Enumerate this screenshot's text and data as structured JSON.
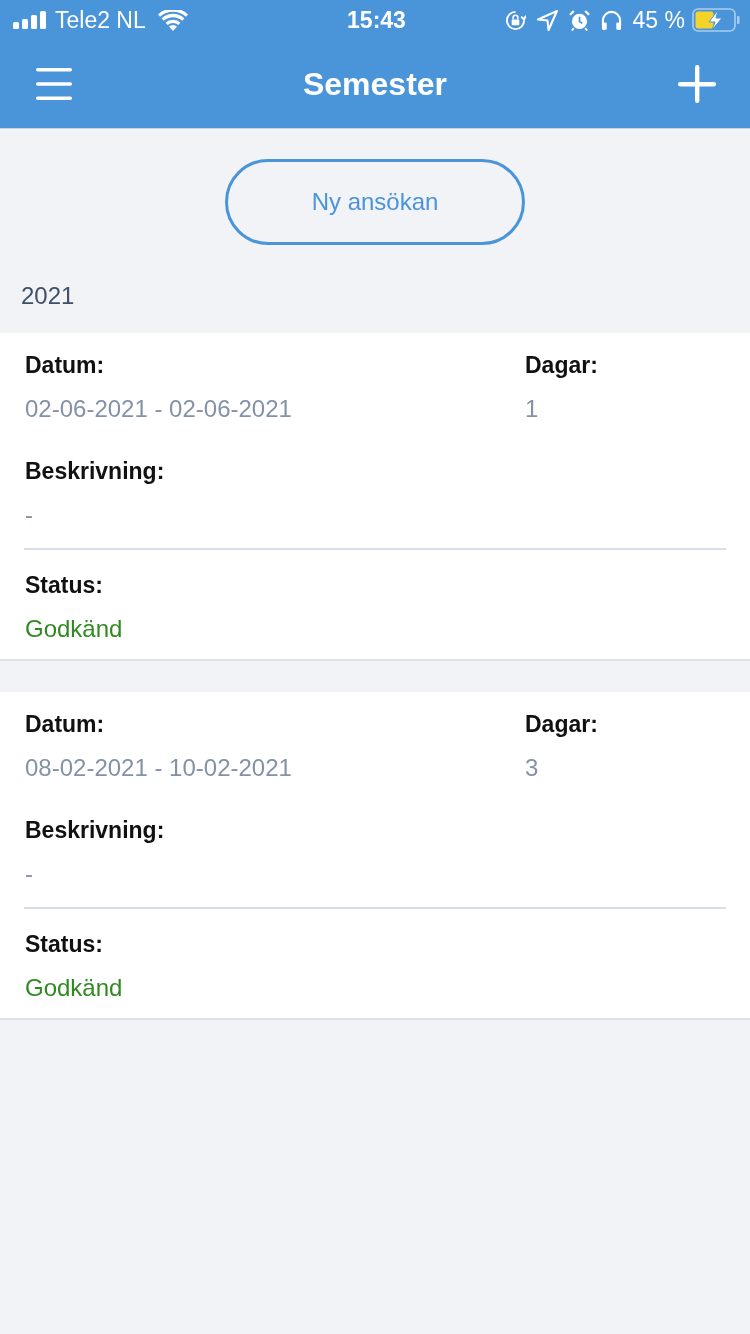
{
  "status_bar": {
    "carrier": "Tele2 NL",
    "time": "15:43",
    "battery_text": "45 %"
  },
  "nav_bar": {
    "title": "Semester"
  },
  "new_request_button": {
    "label": "Ny ansökan"
  },
  "years": [
    {
      "year": "2021",
      "entries": [
        {
          "date_label": "Datum:",
          "date": "02-06-2021 - 02-06-2021",
          "days_label": "Dagar:",
          "days": "1",
          "description_label": "Beskrivning:",
          "description": "-",
          "status_label": "Status:",
          "status": "Godkänd",
          "color": "#2f8a1f"
        },
        {
          "date_label": "Datum:",
          "date": "08-02-2021 - 10-02-2021",
          "days_label": "Dagar:",
          "days": "3",
          "description_label": "Beskrivning:",
          "description": "-",
          "status_label": "Status:",
          "status": "Godkänd",
          "color": "#2f8a1f"
        }
      ]
    }
  ]
}
